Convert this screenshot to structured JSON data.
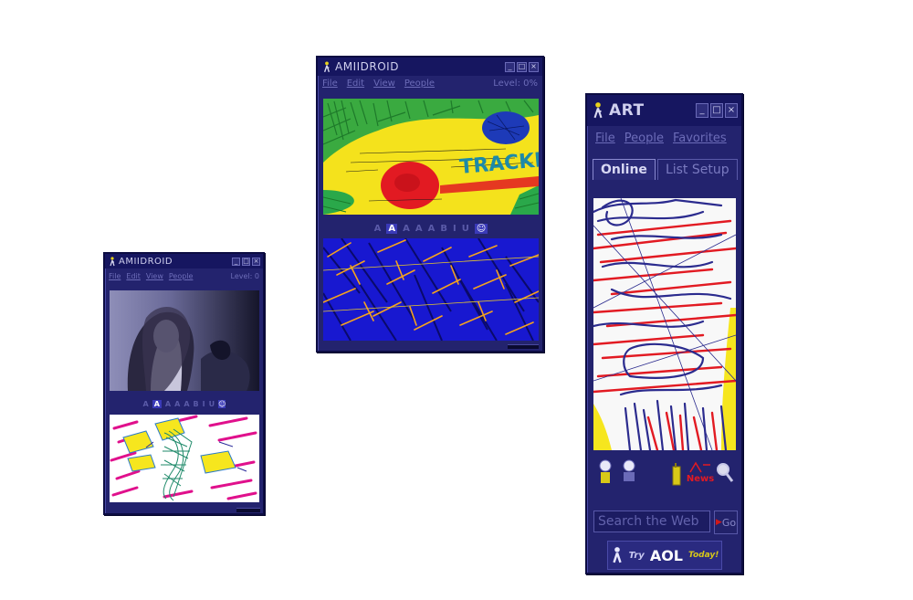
{
  "windows": {
    "small": {
      "title": "AMIIDROID",
      "menu": [
        "File",
        "Edit",
        "View",
        "People"
      ],
      "level": "Level: 0"
    },
    "medium": {
      "title": "AMIIDROID",
      "menu": [
        "File",
        "Edit",
        "View",
        "People"
      ],
      "level": "Level: 0%",
      "doodle_text": "TRACKER"
    },
    "aim": {
      "title": "ART",
      "menu": [
        "File",
        "People",
        "Favorites"
      ],
      "tabs": [
        "Online",
        "List Setup"
      ],
      "news_label": "News",
      "search_placeholder": "Search the Web",
      "go_label": "Go",
      "promo": {
        "prefix": "Try",
        "brand": "AOL",
        "suffix": "Today!"
      }
    }
  },
  "toolbar": [
    "A",
    "A",
    "A",
    "A",
    "A",
    "B",
    "I",
    "U",
    "☺"
  ],
  "colors": {
    "window_bg": "#23236e",
    "titlebar": "#161660",
    "accent_blue": "#3a3ab8",
    "doodle_yellow": "#f6e61e",
    "doodle_red": "#e21a22",
    "doodle_green": "#2aa84a",
    "doodle_magenta": "#e0108c"
  }
}
